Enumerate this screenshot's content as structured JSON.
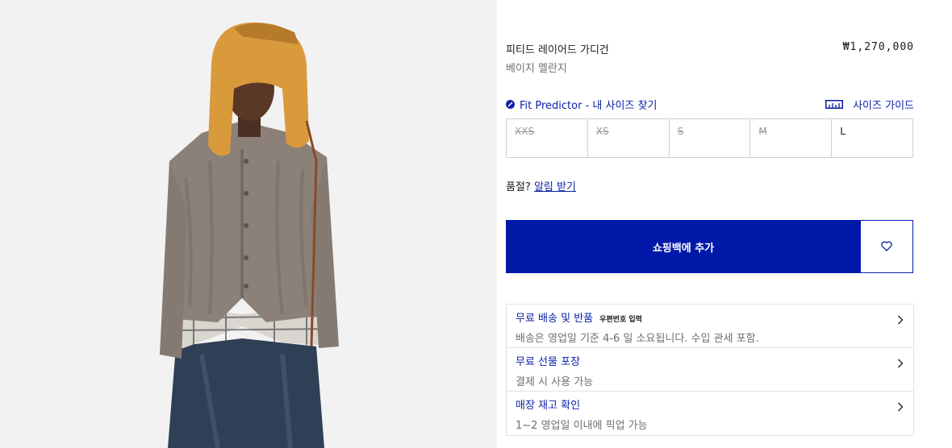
{
  "product": {
    "name": "피티드 레이어드 가디건",
    "color": "베이지 멜란지",
    "price": "₩1,270,000"
  },
  "fit": {
    "predictor_label": "Fit Predictor - 내 사이즈 찾기",
    "size_guide_label": "사이즈 가이드"
  },
  "sizes": [
    {
      "label": "XXS",
      "available": false
    },
    {
      "label": "XS",
      "available": false
    },
    {
      "label": "S",
      "available": false
    },
    {
      "label": "M",
      "available": false
    },
    {
      "label": "L",
      "available": true
    }
  ],
  "soldout": {
    "text": "품절?",
    "link": "알림 받기"
  },
  "actions": {
    "add_to_bag": "쇼핑백에 추가"
  },
  "services": [
    {
      "title": "무료 배송 및 반품",
      "tag": "우편번호 입력",
      "subtitle": "배송은 영업일 기준 4-6 일 소요됩니다. 수입 관세 포함."
    },
    {
      "title": "무료 선물 포장",
      "tag": "",
      "subtitle": "결제 시 사용 가능"
    },
    {
      "title": "매장 재고 확인",
      "tag": "",
      "subtitle": "1~2 영업일 이내에 픽업 가능"
    }
  ],
  "colors": {
    "accent": "#0019a8",
    "link": "#0a1fa6",
    "image_bg": "#f2f2f2"
  },
  "icons": [
    "fit-predictor-icon",
    "ruler-icon",
    "heart-icon",
    "chevron-right-icon"
  ]
}
